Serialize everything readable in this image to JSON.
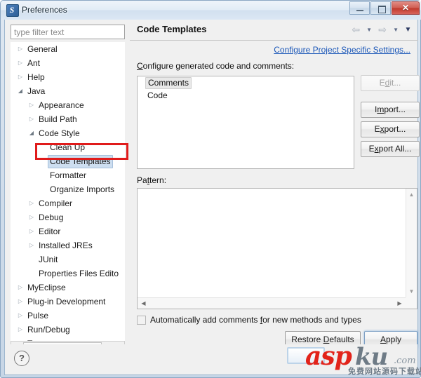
{
  "window": {
    "title": "Preferences",
    "icon": "preferences-app-icon",
    "ghost_title": "",
    "buttons": {
      "minimize": "minimize-button",
      "maximize": "maximize-button",
      "close": "✕"
    }
  },
  "sidebar": {
    "filter": {
      "placeholder": "type filter text",
      "value": ""
    },
    "tree": [
      {
        "label": "General",
        "indent": 0,
        "arrow": "collapsed"
      },
      {
        "label": "Ant",
        "indent": 0,
        "arrow": "collapsed"
      },
      {
        "label": "Help",
        "indent": 0,
        "arrow": "collapsed"
      },
      {
        "label": "Java",
        "indent": 0,
        "arrow": "expanded"
      },
      {
        "label": "Appearance",
        "indent": 1,
        "arrow": "collapsed"
      },
      {
        "label": "Build Path",
        "indent": 1,
        "arrow": "collapsed"
      },
      {
        "label": "Code Style",
        "indent": 1,
        "arrow": "expanded"
      },
      {
        "label": "Clean Up",
        "indent": 2,
        "arrow": "none"
      },
      {
        "label": "Code Templates",
        "indent": 2,
        "arrow": "none",
        "selected": true
      },
      {
        "label": "Formatter",
        "indent": 2,
        "arrow": "none"
      },
      {
        "label": "Organize Imports",
        "indent": 2,
        "arrow": "none"
      },
      {
        "label": "Compiler",
        "indent": 1,
        "arrow": "collapsed"
      },
      {
        "label": "Debug",
        "indent": 1,
        "arrow": "collapsed"
      },
      {
        "label": "Editor",
        "indent": 1,
        "arrow": "collapsed"
      },
      {
        "label": "Installed JREs",
        "indent": 1,
        "arrow": "collapsed"
      },
      {
        "label": "JUnit",
        "indent": 1,
        "arrow": "none"
      },
      {
        "label": "Properties Files Edito",
        "indent": 1,
        "arrow": "none"
      },
      {
        "label": "MyEclipse",
        "indent": 0,
        "arrow": "collapsed"
      },
      {
        "label": "Plug-in Development",
        "indent": 0,
        "arrow": "collapsed"
      },
      {
        "label": "Pulse",
        "indent": 0,
        "arrow": "collapsed"
      },
      {
        "label": "Run/Debug",
        "indent": 0,
        "arrow": "collapsed"
      },
      {
        "label": "Team",
        "indent": 0,
        "arrow": "collapsed"
      }
    ],
    "hscroll": {
      "left_arrow": "◀",
      "right_arrow": "▶",
      "grip": "‖"
    },
    "annotation": {
      "type": "red-highlight-rectangle",
      "target": "Code Templates",
      "color": "#e01b1b"
    }
  },
  "page": {
    "title": "Code Templates",
    "nav": {
      "back": "⇦",
      "back_menu": "▼",
      "forward": "⇨",
      "forward_menu": "▼",
      "view_menu": "▼"
    },
    "project_link": "Configure Project Specific Settings...",
    "configure_label_prefix": "C",
    "configure_label_rest": "onfigure generated code and comments:",
    "templates": [
      {
        "label": "Comments",
        "selected": true
      },
      {
        "label": "Code",
        "selected": false
      }
    ],
    "side_buttons": [
      {
        "name": "edit-button",
        "prefix": "E",
        "underline": "d",
        "suffix": "it...",
        "disabled": true
      },
      {
        "name": "import-button",
        "prefix": "I",
        "underline": "m",
        "suffix": "port...",
        "disabled": false
      },
      {
        "name": "export-button",
        "prefix": "E",
        "underline": "x",
        "suffix": "port...",
        "disabled": false
      },
      {
        "name": "export-all-button",
        "prefix": "E",
        "underline": "x",
        "suffix": "port All...",
        "disabled": false
      }
    ],
    "pattern_label_prefix": "Pa",
    "pattern_label_underline": "t",
    "pattern_label_suffix": "tern:",
    "pattern_value": "",
    "pattern_scroll": {
      "up": "▲",
      "down": "▼",
      "left": "◀",
      "right": "▶"
    },
    "checkbox": {
      "checked": false,
      "prefix": "Automatically add comments ",
      "underline": "f",
      "suffix": "or new methods and types"
    },
    "bottom_buttons": {
      "restore_prefix": "Restore ",
      "restore_underline": "D",
      "restore_suffix": "efaults",
      "apply_underline": "A",
      "apply_suffix": "pply"
    }
  },
  "footer": {
    "help_icon": "?"
  },
  "watermark": {
    "text_red": "asp",
    "text_grey": "ku",
    "text_com": ".com",
    "text_cn": "免费网站源码下载站",
    "color_red": "#e2231a",
    "color_grey": "#6e7b86"
  }
}
